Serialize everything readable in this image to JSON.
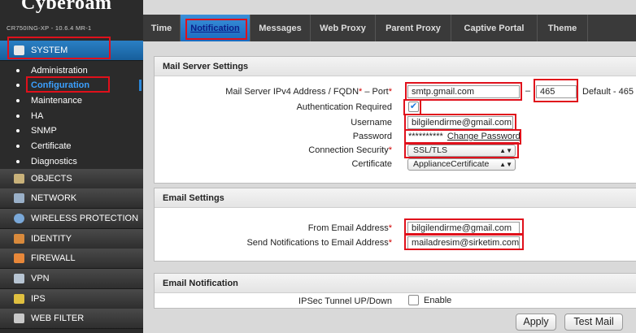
{
  "brand": "Cyberoam",
  "model": "CR750ING-XP - 10.6.4 MR-1",
  "sidebar": {
    "sections": [
      {
        "label": "SYSTEM",
        "icon": "system-icon"
      },
      {
        "label": "OBJECTS",
        "icon": "objects-icon"
      },
      {
        "label": "NETWORK",
        "icon": "network-icon"
      },
      {
        "label": "WIRELESS PROTECTION",
        "icon": "wireless-icon"
      },
      {
        "label": "IDENTITY",
        "icon": "identity-icon"
      },
      {
        "label": "FIREWALL",
        "icon": "firewall-icon"
      },
      {
        "label": "VPN",
        "icon": "vpn-icon"
      },
      {
        "label": "IPS",
        "icon": "ips-icon"
      },
      {
        "label": "WEB FILTER",
        "icon": "web-filter-icon"
      }
    ],
    "system_items": [
      "Administration",
      "Configuration",
      "Maintenance",
      "HA",
      "SNMP",
      "Certificate",
      "Diagnostics"
    ],
    "active_item": "Configuration"
  },
  "tabs": [
    "Time",
    "Notification",
    "Messages",
    "Web Proxy",
    "Parent Proxy",
    "Captive Portal",
    "Theme"
  ],
  "active_tab": "Notification",
  "mail_server": {
    "title": "Mail Server Settings",
    "address_label": "Mail Server IPv4 Address / FQDN",
    "port_label": "Port",
    "address_value": "smtp.gmail.com",
    "port_value": "465",
    "default_text": "Default - 465",
    "auth_label": "Authentication Required",
    "auth_checked": true,
    "username_label": "Username",
    "username_value": "bilgilendirme@gmail.com",
    "password_label": "Password",
    "password_mask": "**********",
    "change_password": "Change Password",
    "security_label": "Connection Security",
    "security_value": "SSL/TLS",
    "certificate_label": "Certificate",
    "certificate_value": "ApplianceCertificate",
    "dash": "–"
  },
  "email_settings": {
    "title": "Email Settings",
    "from_label": "From Email Address",
    "from_value": "bilgilendirme@gmail.com",
    "to_label": "Send Notifications to Email Address",
    "to_value": "mailadresim@sirketim.com"
  },
  "email_notification": {
    "title": "Email Notification",
    "ipsec_label": "IPSec Tunnel UP/Down",
    "enable_label": "Enable"
  },
  "buttons": {
    "apply": "Apply",
    "test_mail": "Test Mail"
  },
  "colors": {
    "annotation": "#e0101b",
    "accent": "#1f7ae0"
  }
}
